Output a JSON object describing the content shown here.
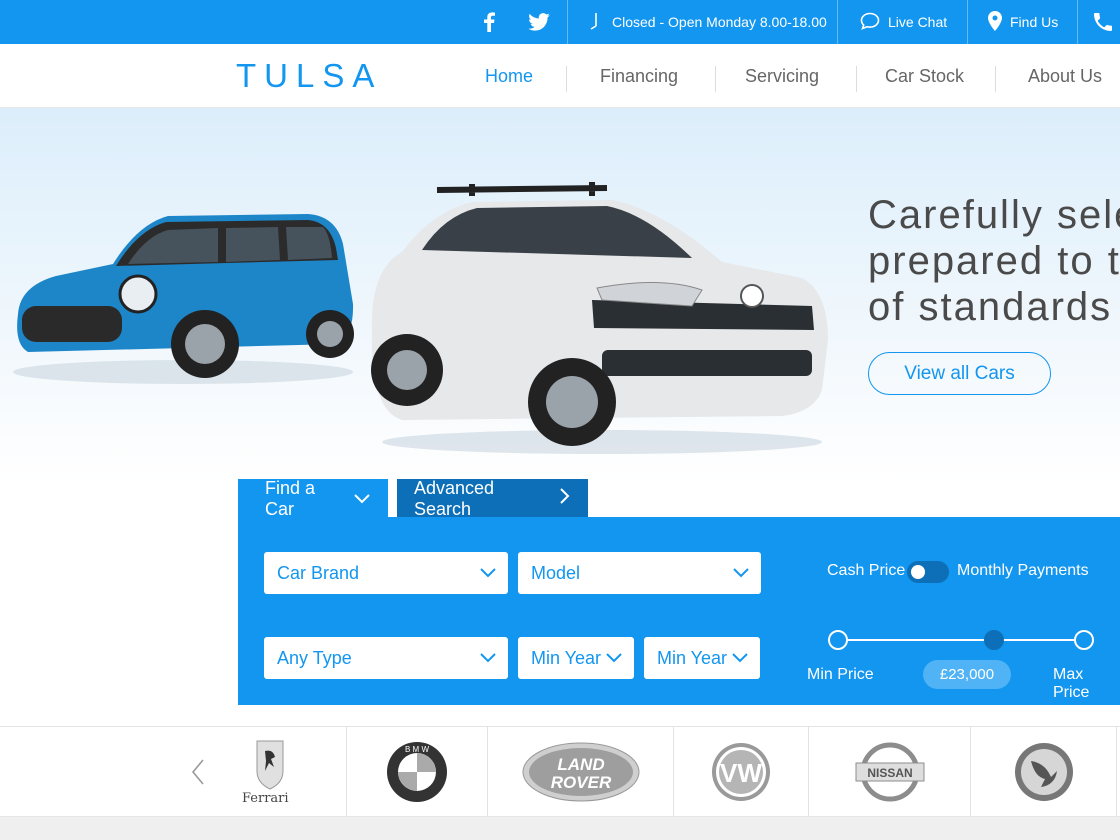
{
  "topbar": {
    "social": [
      "facebook-icon",
      "twitter-icon"
    ],
    "hours": "Closed - Open Monday 8.00-18.00",
    "live_chat": "Live Chat",
    "find_us": "Find Us"
  },
  "header": {
    "logo": "TULSA",
    "nav": [
      "Home",
      "Financing",
      "Servicing",
      "Car Stock",
      "About Us"
    ],
    "active": "Home"
  },
  "hero": {
    "headline_lines": [
      "Carefully sele",
      "prepared to t",
      "of standards"
    ],
    "cta": "View all Cars"
  },
  "search": {
    "tabs": [
      "Find a Car",
      "Advanced Search"
    ],
    "fields": {
      "brand": "Car Brand",
      "model": "Model",
      "type": "Any Type",
      "min_year_1": "Min Year",
      "min_year_2": "Min Year"
    },
    "toggle": {
      "left": "Cash Price",
      "right": "Monthly Payments"
    },
    "price": {
      "min_label": "Min Price",
      "max_label": "Max Price",
      "value": "£23,000",
      "fraction": 0.63
    }
  },
  "brands": {
    "items": [
      "Ferrari",
      "BMW",
      "LAND ROVER",
      "VW",
      "NISSAN",
      "Vauxhall"
    ],
    "bmw_letters": "B M W",
    "land_rover_lines": [
      "LAND",
      "ROVER"
    ],
    "vw_letters": "VW",
    "nissan_text": "NISSAN"
  },
  "colors": {
    "primary": "#1396ef",
    "dark": "#0d6fb8",
    "light": "#4fb3f5"
  }
}
